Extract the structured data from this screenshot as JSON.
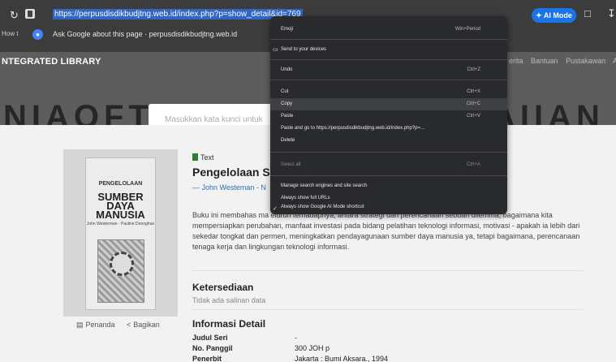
{
  "browser": {
    "url": "https://perpusdisdikbudjtng.web.id/index.php?p=show_detail&id=769",
    "ai_mode_label": "AI Mode",
    "bookmark_fragment": "How t",
    "suggestion": "Ask Google about this page · perpusdisdikbudjtng.web.id"
  },
  "site": {
    "brand": "NTEGRATED LIBRARY",
    "nav": [
      "erita",
      "Bantuan",
      "Pustakawan",
      "A"
    ],
    "search_placeholder": "Masukkan kata kunci untuk",
    "banner_word": "NIAOFT",
    "banner_word_right": "AIIAN"
  },
  "book": {
    "cover_line1": "PENGELOLAAN",
    "cover_line2": "SUMBER DAYA MANUSIA",
    "cover_line3": "John Westerman · Pauline Donoghue",
    "type": "Text",
    "title": "Pengelolaan Su",
    "author": "— John Westeman - N",
    "description": "Buku ini membahas ma                                                                          eluruh terhadapnya, antara strategi dan perencanaan sebuah dilemma, bagaimana kita mempersiapkan perubahan, manfaat investasi pada bidang pelatihan teknologi informasi, motivasi - apakah ia lebih dari sekedar tongkat dan permen, meningkatkan pendayagunaan sumber daya manusia ya, tetapi bagaimana, perencanaan tenaga kerja dan lingkungan teknologi informasi.",
    "bookmark_label": "Penanda",
    "share_label": "Bagikan",
    "availability_heading": "Ketersediaan",
    "availability_text": "Tidak ada salinan data",
    "info_heading": "Informasi Detail",
    "info": [
      {
        "key": "Judul Seri",
        "value": "-"
      },
      {
        "key": "No. Panggil",
        "value": "300 JOH p"
      },
      {
        "key": "Penerbit",
        "value": "Jakarta : Bumi Aksara., 1994"
      }
    ]
  },
  "context_menu": {
    "items": [
      {
        "label": "Emoji",
        "shortcut": "Win+Period"
      },
      {
        "label": "Send to your devices",
        "shortcut": ""
      },
      {
        "label": "Undo",
        "shortcut": "Ctrl+Z"
      },
      {
        "label": "Cut",
        "shortcut": "Ctrl+X"
      },
      {
        "label": "Copy",
        "shortcut": "Ctrl+C"
      },
      {
        "label": "Paste",
        "shortcut": "Ctrl+V"
      },
      {
        "label": "Paste and go to https://perpusdisdikbudjtng.web.id/index.php?p=...",
        "shortcut": ""
      },
      {
        "label": "Delete",
        "shortcut": ""
      },
      {
        "label": "Select all",
        "shortcut": "Ctrl+A"
      },
      {
        "label": "Manage search engines and site search",
        "shortcut": ""
      },
      {
        "label": "Always show full URLs",
        "shortcut": ""
      },
      {
        "label": "Always show Google AI Mode shortcut",
        "shortcut": ""
      }
    ]
  }
}
